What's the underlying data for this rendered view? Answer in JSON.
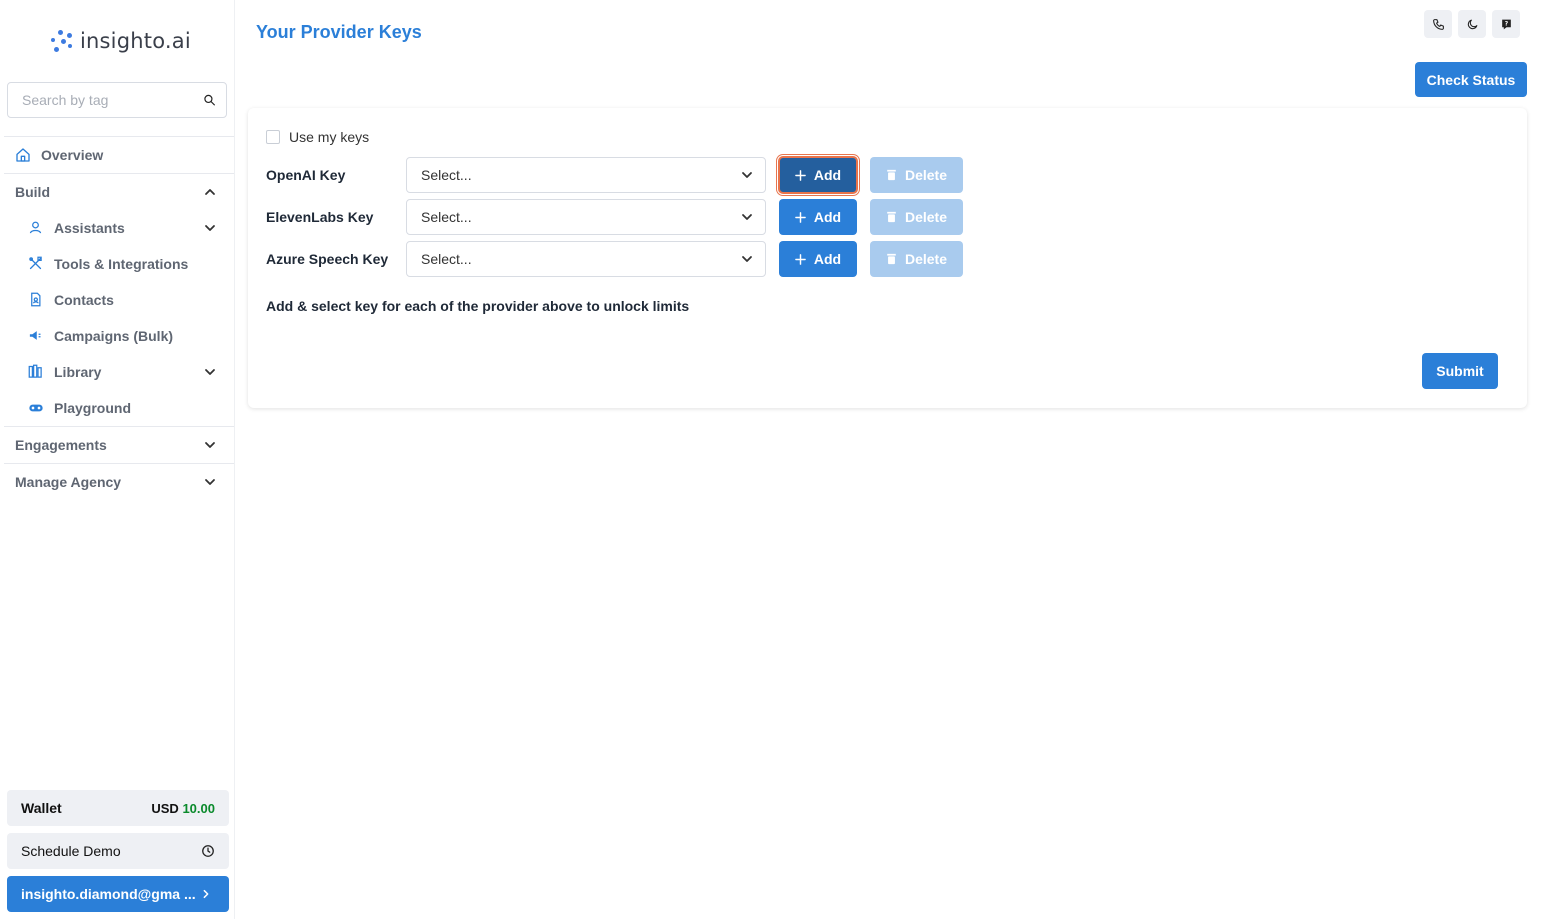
{
  "brand": {
    "name": "insighto.ai",
    "color": "#2b7fd8"
  },
  "search": {
    "placeholder": "Search by tag",
    "icon": "search-icon"
  },
  "nav": {
    "overview": "Overview",
    "build": "Build",
    "build_items": [
      {
        "label": "Assistants",
        "icon": "user-icon",
        "expandable": true
      },
      {
        "label": "Tools & Integrations",
        "icon": "tools-icon",
        "expandable": false
      },
      {
        "label": "Contacts",
        "icon": "contacts-icon",
        "expandable": false
      },
      {
        "label": "Campaigns (Bulk)",
        "icon": "megaphone-icon",
        "expandable": false
      },
      {
        "label": "Library",
        "icon": "library-icon",
        "expandable": true
      },
      {
        "label": "Playground",
        "icon": "gamepad-icon",
        "expandable": false
      }
    ],
    "engagements": "Engagements",
    "manage_agency": "Manage Agency"
  },
  "wallet": {
    "label": "Wallet",
    "currency": "USD",
    "amount": "10.00"
  },
  "schedule_demo": "Schedule Demo",
  "user": {
    "email": "insighto.diamond@gma ..."
  },
  "header": {
    "title": "Your Provider Keys",
    "icons": [
      "phone-icon",
      "moon-icon",
      "help-icon"
    ],
    "check_status": "Check Status"
  },
  "form": {
    "use_my_keys": "Use my keys",
    "rows": [
      {
        "label": "OpenAI Key",
        "select": "Select...",
        "add": "Add",
        "delete": "Delete"
      },
      {
        "label": "ElevenLabs Key",
        "select": "Select...",
        "add": "Add",
        "delete": "Delete"
      },
      {
        "label": "Azure Speech Key",
        "select": "Select...",
        "add": "Add",
        "delete": "Delete"
      }
    ],
    "hint": "Add & select key for each of the provider above to unlock limits",
    "submit": "Submit"
  }
}
